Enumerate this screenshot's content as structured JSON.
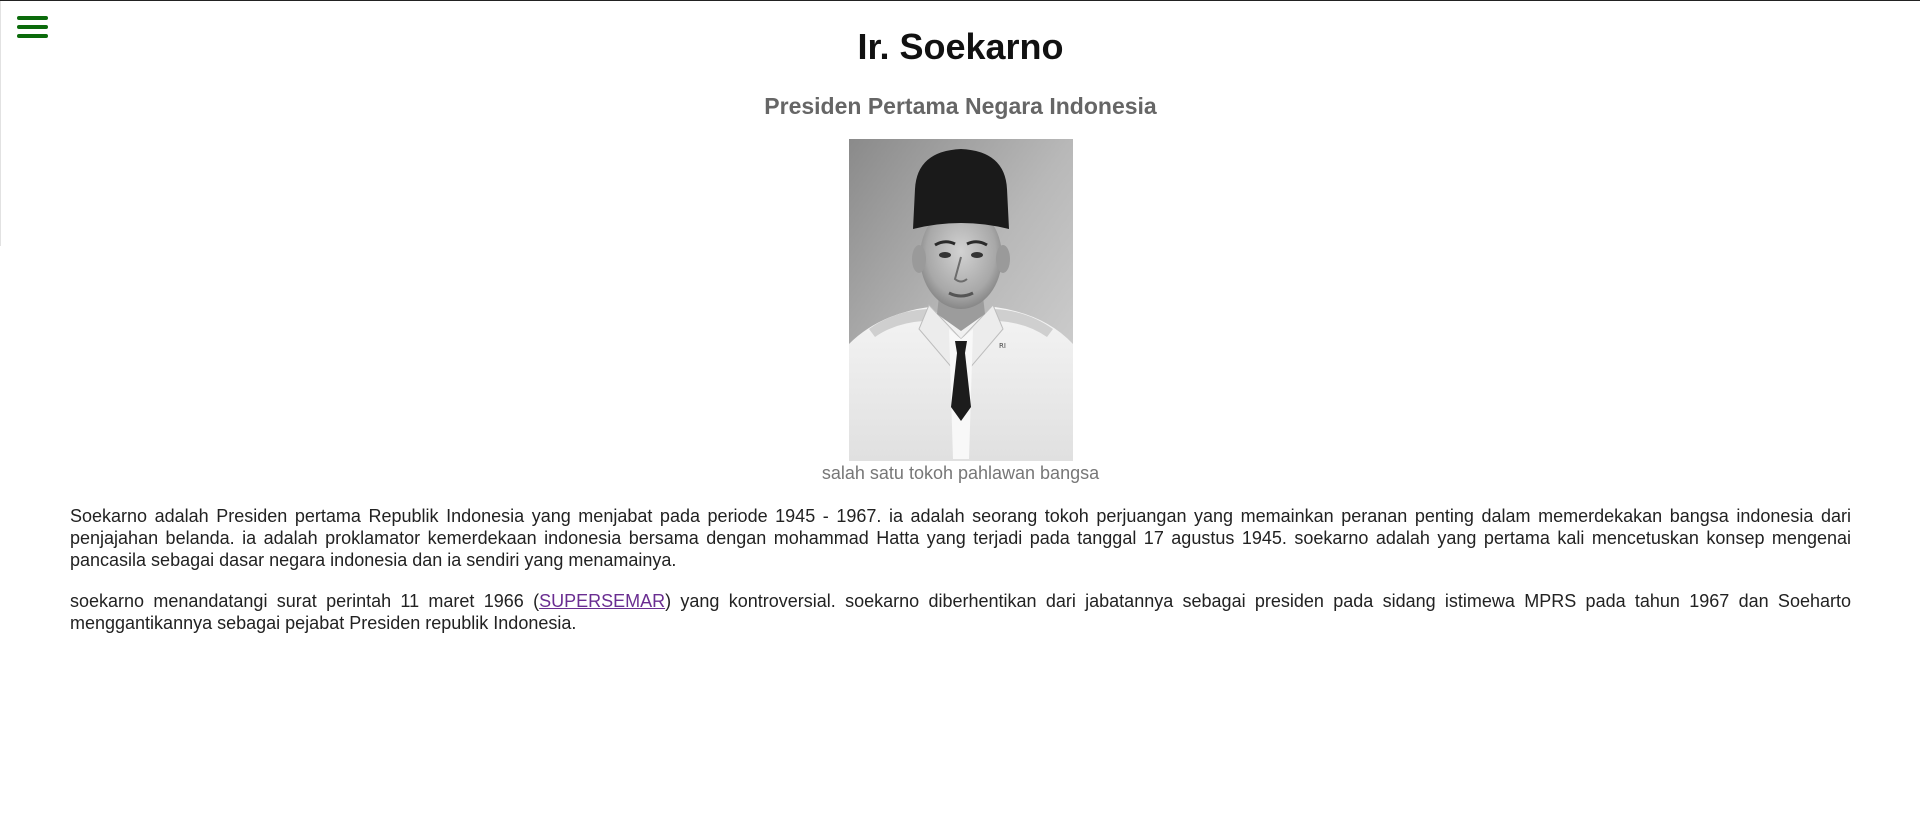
{
  "menu": {
    "icon": "hamburger-menu-icon",
    "color": "#0b6b0b"
  },
  "header": {
    "title": "Ir. Soekarno",
    "subtitle": "Presiden Pertama Negara Indonesia"
  },
  "figure": {
    "caption": "salah satu tokoh pahlawan bangsa"
  },
  "article": {
    "paragraph1": "Soekarno adalah Presiden pertama Republik Indonesia yang menjabat pada periode 1945 - 1967. ia adalah seorang tokoh perjuangan yang memainkan peranan penting dalam memerdekakan bangsa indonesia dari penjajahan belanda. ia adalah proklamator kemerdekaan indonesia bersama dengan mohammad Hatta yang terjadi pada tanggal 17 agustus 1945. soekarno adalah yang pertama kali mencetuskan konsep mengenai pancasila sebagai dasar negara indonesia dan ia sendiri yang menamainya.",
    "paragraph2_before": "soekarno menandatangi surat perintah 11 maret 1966 (",
    "paragraph2_link": "SUPERSEMAR",
    "paragraph2_after": ") yang kontroversial. soekarno diberhentikan dari jabatannya sebagai presiden pada sidang istimewa MPRS pada tahun 1967 dan Soeharto menggantikannya sebagai pejabat Presiden republik Indonesia."
  }
}
